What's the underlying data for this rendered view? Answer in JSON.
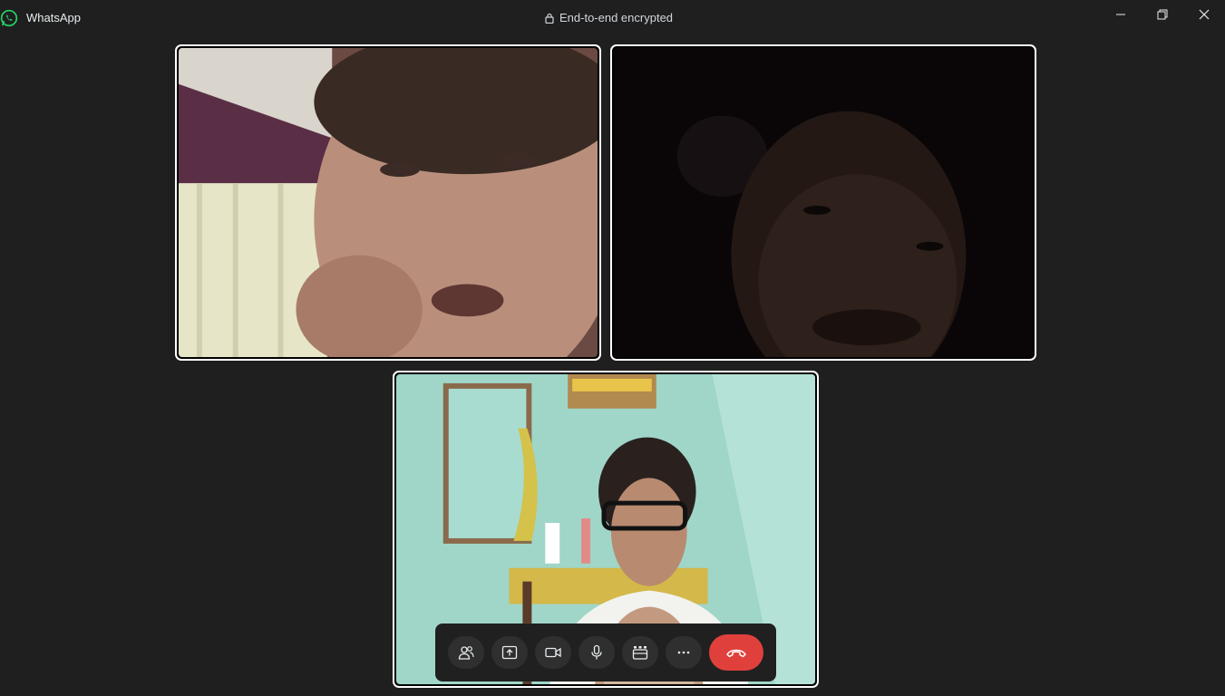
{
  "window": {
    "app_name": "WhatsApp",
    "encryption_label": "End-to-end encrypted"
  },
  "colors": {
    "background": "#1f1f1f",
    "brand_green": "#25d366",
    "end_call_red": "#e0403c",
    "tile_border": "#ffffff"
  },
  "participants": [
    {
      "icon": "video-feed-participant-1"
    },
    {
      "icon": "video-feed-participant-2"
    },
    {
      "icon": "video-feed-self"
    }
  ],
  "controls": [
    {
      "icon": "participants-icon"
    },
    {
      "icon": "share-screen-icon"
    },
    {
      "icon": "camera-icon"
    },
    {
      "icon": "microphone-icon"
    },
    {
      "icon": "effects-icon"
    },
    {
      "icon": "more-options-icon"
    },
    {
      "icon": "end-call-icon"
    }
  ]
}
